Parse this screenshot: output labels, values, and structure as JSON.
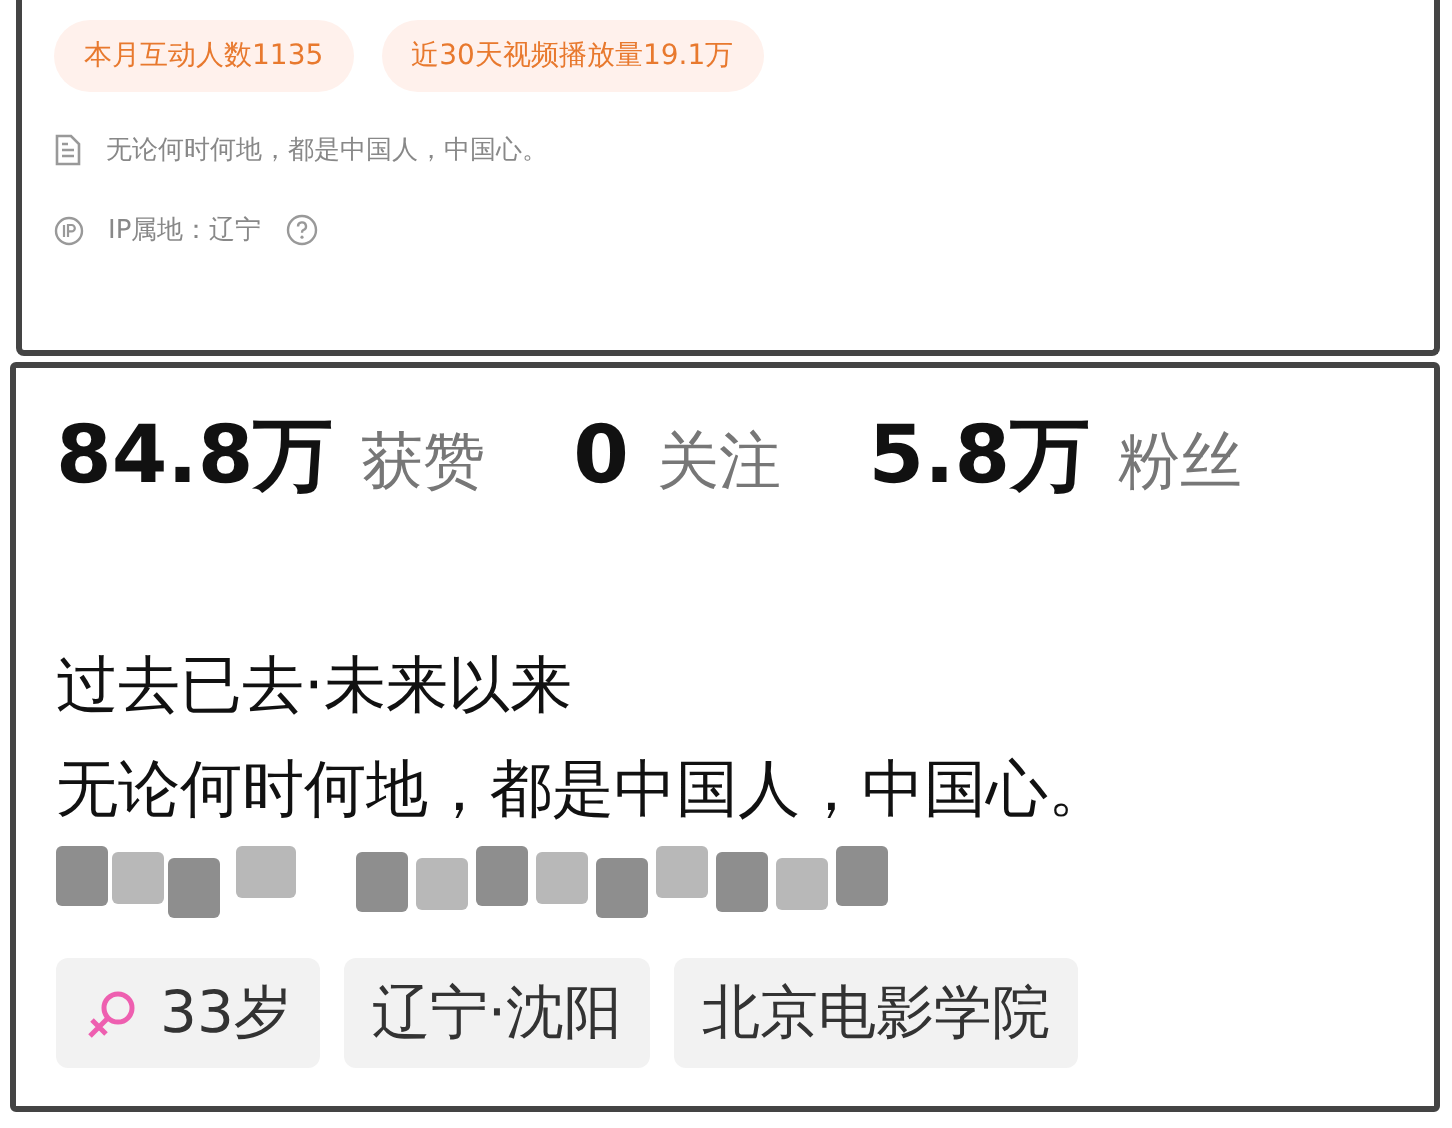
{
  "top_panel": {
    "badges": [
      "本月互动人数1135",
      "近30天视频播放量19.1万"
    ],
    "bio": "无论何时何地，都是中国人，中国心。",
    "ip_location": "IP属地：辽宁"
  },
  "profile": {
    "stats": [
      "**84.8万** 获赞",
      "**0** 关注",
      "**5.8万** 粉丝"
    ],
    "bio_lines": [
      "过去已去·未来以来",
      "无论何时何地，都是中国人，中国心。"
    ],
    "tags": [
      {
        "kind": "gender",
        "label": "33岁"
      },
      {
        "kind": "text",
        "label": "辽宁·沈阳"
      },
      {
        "kind": "text",
        "label": "北京电影学院"
      }
    ]
  }
}
